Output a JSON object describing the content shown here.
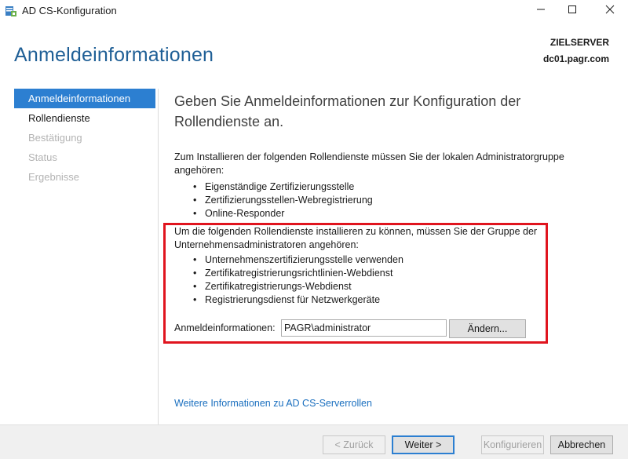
{
  "window": {
    "title": "AD CS-Konfiguration",
    "icons": {
      "app": "server-config-icon",
      "minimize": "minimize-icon",
      "maximize": "maximize-icon",
      "close": "close-icon"
    }
  },
  "header": {
    "title": "Anmeldeinformationen",
    "target_label": "ZIELSERVER",
    "target_value": "dc01.pagr.com"
  },
  "nav": {
    "items": [
      {
        "label": "Anmeldeinformationen",
        "state": "active"
      },
      {
        "label": "Rollendienste",
        "state": "enabled"
      },
      {
        "label": "Bestätigung",
        "state": "disabled"
      },
      {
        "label": "Status",
        "state": "disabled"
      },
      {
        "label": "Ergebnisse",
        "state": "disabled"
      }
    ]
  },
  "main": {
    "heading": "Geben Sie Anmeldeinformationen zur Konfiguration der Rollendienste an.",
    "local_admin_text": "Zum Installieren der folgenden Rollendienste müssen Sie der lokalen Administratorgruppe angehören:",
    "local_admin_services": [
      "Eigenständige Zertifizierungsstelle",
      "Zertifizierungsstellen-Webregistrierung",
      "Online-Responder"
    ],
    "enterprise_admin_text": "Um die folgenden Rollendienste installieren zu können, müssen Sie der Gruppe der Unternehmensadministratoren angehören:",
    "enterprise_admin_services": [
      "Unternehmenszertifizierungsstelle verwenden",
      "Zertifikatregistrierungsrichtlinien-Webdienst",
      "Zertifikatregistrierungs-Webdienst",
      "Registrierungsdienst für Netzwerkgeräte"
    ],
    "credentials_label": "Anmeldeinformationen:",
    "credentials_value": "PAGR\\administrator",
    "change_button": "Ändern...",
    "more_info_link": "Weitere Informationen zu AD CS-Serverrollen",
    "highlight_color": "#e0141e"
  },
  "footer": {
    "back": "< Zurück",
    "next": "Weiter >",
    "configure": "Konfigurieren",
    "cancel": "Abbrechen"
  },
  "colors": {
    "accent": "#2c7fd1",
    "title_blue": "#1f5f96",
    "link": "#1a6fbf"
  }
}
